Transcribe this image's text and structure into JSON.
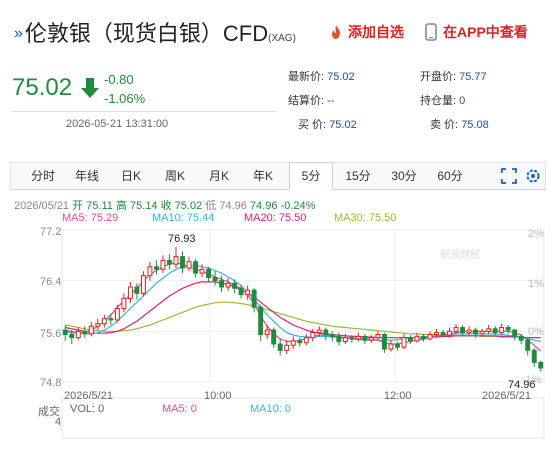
{
  "header": {
    "title": "伦敦银（现货白银）CFD",
    "title_sub": "(XAG)",
    "fav_label": "添加自选",
    "app_label": "在APP中查看"
  },
  "quote": {
    "price": "75.02",
    "change": "-0.80",
    "change_pct": "-1.06%",
    "time": "2026-05-21 13:31:00"
  },
  "stats": {
    "latest_label": "最新价:",
    "latest": "75.02",
    "open_label": "开盘价:",
    "open": "75.77",
    "settle_label": "结算价:",
    "settle": "--",
    "oi_label": "持仓量:",
    "oi": "0",
    "bid_label": "买  价:",
    "bid": "75.02",
    "ask_label": "卖  价:",
    "ask": "75.08"
  },
  "tabs": [
    "分时",
    "年线",
    "日K",
    "周K",
    "月K",
    "年K",
    "5分",
    "15分",
    "30分",
    "60分"
  ],
  "active_tab": "5分",
  "infoline": {
    "date": "2026/05/21",
    "open": "开 75.11",
    "high": "高 75.14",
    "close": "收 75.02",
    "low": "低 74.96",
    "chg": "74.96 -0.24%"
  },
  "ma": {
    "ma5": "MA5: 75.29",
    "ma10": "MA10: 75.44",
    "ma20": "MA20: 75.50",
    "ma30": "MA30: 75.50"
  },
  "colors": {
    "up": "#e02020",
    "down": "#1e8c3a",
    "ma5": "#e84a8a",
    "ma10": "#35b5e5",
    "ma20": "#d4247a",
    "ma30": "#9ab83a"
  },
  "chart": {
    "y_ticks": [
      "77.2",
      "76.4",
      "75.6",
      "74.8"
    ],
    "pct_ticks": [
      "2%",
      "1%",
      "0%",
      "-1%"
    ],
    "x_ticks": [
      "2026/5/21",
      "10:00",
      "12:00",
      "2026/5/21"
    ],
    "max_label": "76.93",
    "min_label": "74.96",
    "watermark": "新浪财经"
  },
  "volume": {
    "label": "成交",
    "value": "4",
    "vol": "VOL: 0",
    "ma5": "MA5: 0",
    "ma10": "MA10: 0"
  },
  "chart_data": {
    "type": "candlestick",
    "ylim": [
      74.8,
      77.2
    ],
    "candles": [
      [
        75.62,
        75.55,
        75.7,
        75.45
      ],
      [
        75.55,
        75.5,
        75.62,
        75.4
      ],
      [
        75.5,
        75.6,
        75.66,
        75.46
      ],
      [
        75.6,
        75.56,
        75.68,
        75.5
      ],
      [
        75.56,
        75.68,
        75.75,
        75.52
      ],
      [
        75.68,
        75.72,
        75.8,
        75.62
      ],
      [
        75.72,
        75.8,
        75.86,
        75.66
      ],
      [
        75.8,
        75.78,
        75.88,
        75.7
      ],
      [
        75.78,
        75.96,
        76.02,
        75.74
      ],
      [
        75.96,
        76.12,
        76.2,
        75.9
      ],
      [
        76.12,
        76.3,
        76.38,
        76.05
      ],
      [
        76.3,
        76.2,
        76.36,
        76.1
      ],
      [
        76.2,
        76.48,
        76.55,
        76.15
      ],
      [
        76.48,
        76.62,
        76.7,
        76.4
      ],
      [
        76.62,
        76.58,
        76.72,
        76.5
      ],
      [
        76.58,
        76.72,
        76.8,
        76.52
      ],
      [
        76.72,
        76.66,
        76.82,
        76.58
      ],
      [
        76.66,
        76.78,
        76.93,
        76.6
      ],
      [
        76.78,
        76.6,
        76.86,
        76.52
      ],
      [
        76.6,
        76.7,
        76.78,
        76.55
      ],
      [
        76.7,
        76.52,
        76.74,
        76.45
      ],
      [
        76.52,
        76.58,
        76.66,
        76.46
      ],
      [
        76.58,
        76.45,
        76.62,
        76.38
      ],
      [
        76.45,
        76.4,
        76.55,
        76.32
      ],
      [
        76.4,
        76.3,
        76.48,
        76.22
      ],
      [
        76.3,
        76.36,
        76.44,
        76.24
      ],
      [
        76.36,
        76.28,
        76.42,
        76.2
      ],
      [
        76.28,
        76.18,
        76.34,
        76.12
      ],
      [
        76.18,
        76.25,
        76.32,
        76.1
      ],
      [
        76.25,
        75.98,
        76.28,
        75.9
      ],
      [
        75.98,
        75.55,
        76.02,
        75.45
      ],
      [
        75.55,
        75.62,
        75.7,
        75.48
      ],
      [
        75.62,
        75.4,
        75.66,
        75.34
      ],
      [
        75.4,
        75.3,
        75.48,
        75.22
      ],
      [
        75.3,
        75.38,
        75.46,
        75.24
      ],
      [
        75.38,
        75.45,
        75.52,
        75.32
      ],
      [
        75.45,
        75.42,
        75.5,
        75.36
      ],
      [
        75.42,
        75.5,
        75.56,
        75.38
      ],
      [
        75.5,
        75.58,
        75.64,
        75.44
      ],
      [
        75.58,
        75.62,
        75.68,
        75.52
      ],
      [
        75.62,
        75.55,
        75.66,
        75.46
      ],
      [
        75.55,
        75.52,
        75.6,
        75.44
      ],
      [
        75.52,
        75.44,
        75.58,
        75.38
      ],
      [
        75.44,
        75.5,
        75.56,
        75.4
      ],
      [
        75.5,
        75.48,
        75.54,
        75.42
      ],
      [
        75.48,
        75.52,
        75.58,
        75.44
      ],
      [
        75.52,
        75.46,
        75.56,
        75.4
      ],
      [
        75.46,
        75.5,
        75.54,
        75.42
      ],
      [
        75.5,
        75.55,
        75.6,
        75.46
      ],
      [
        75.55,
        75.32,
        75.58,
        75.26
      ],
      [
        75.32,
        75.4,
        75.46,
        75.28
      ],
      [
        75.4,
        75.35,
        75.44,
        75.3
      ],
      [
        75.35,
        75.5,
        75.56,
        75.32
      ],
      [
        75.5,
        75.45,
        75.54,
        75.4
      ],
      [
        75.45,
        75.52,
        75.58,
        75.42
      ],
      [
        75.52,
        75.48,
        75.56,
        75.44
      ],
      [
        75.48,
        75.55,
        75.6,
        75.46
      ],
      [
        75.55,
        75.58,
        75.64,
        75.5
      ],
      [
        75.58,
        75.54,
        75.62,
        75.5
      ],
      [
        75.54,
        75.6,
        75.66,
        75.5
      ],
      [
        75.6,
        75.66,
        75.72,
        75.56
      ],
      [
        75.66,
        75.58,
        75.7,
        75.52
      ],
      [
        75.58,
        75.62,
        75.68,
        75.54
      ],
      [
        75.62,
        75.56,
        75.66,
        75.5
      ],
      [
        75.56,
        75.6,
        75.64,
        75.52
      ],
      [
        75.6,
        75.64,
        75.7,
        75.56
      ],
      [
        75.64,
        75.58,
        75.68,
        75.54
      ],
      [
        75.58,
        75.66,
        75.72,
        75.54
      ],
      [
        75.66,
        75.62,
        75.7,
        75.56
      ],
      [
        75.62,
        75.52,
        75.64,
        75.46
      ],
      [
        75.52,
        75.46,
        75.56,
        75.4
      ],
      [
        75.46,
        75.3,
        75.5,
        75.22
      ],
      [
        75.3,
        75.11,
        75.34,
        75.04
      ],
      [
        75.11,
        75.02,
        75.14,
        74.96
      ]
    ],
    "ma5": [
      75.6,
      75.58,
      75.57,
      75.58,
      75.62,
      75.68,
      75.76,
      75.86,
      75.98,
      76.08,
      76.18,
      76.28,
      76.4,
      76.5,
      76.56,
      76.62,
      76.66,
      76.68,
      76.66,
      76.62,
      76.58,
      76.55,
      76.5,
      76.46,
      76.42,
      76.38,
      76.32,
      76.28,
      76.18,
      76.04,
      75.84,
      75.68,
      75.56,
      75.48,
      75.44,
      75.44,
      75.46,
      75.48,
      75.52,
      75.54,
      75.54,
      75.53,
      75.51,
      75.5,
      75.49,
      75.49,
      75.48,
      75.48,
      75.46,
      75.42,
      75.4,
      75.4,
      75.42,
      75.44,
      75.46,
      75.48,
      75.5,
      75.52,
      75.54,
      75.56,
      75.58,
      75.6,
      75.6,
      75.6,
      75.6,
      75.6,
      75.6,
      75.6,
      75.6,
      75.58,
      75.54,
      75.46,
      75.38,
      75.29
    ],
    "ma10": [
      75.62,
      75.6,
      75.58,
      75.56,
      75.56,
      75.58,
      75.62,
      75.68,
      75.76,
      75.86,
      75.96,
      76.06,
      76.16,
      76.26,
      76.36,
      76.44,
      76.52,
      76.58,
      76.62,
      76.64,
      76.64,
      76.62,
      76.6,
      76.56,
      76.52,
      76.46,
      76.4,
      76.32,
      76.22,
      76.1,
      75.98,
      75.86,
      75.76,
      75.66,
      75.58,
      75.54,
      75.52,
      75.51,
      75.51,
      75.52,
      75.52,
      75.51,
      75.5,
      75.49,
      75.48,
      75.47,
      75.46,
      75.46,
      75.46,
      75.46,
      75.46,
      75.47,
      75.48,
      75.49,
      75.5,
      75.51,
      75.52,
      75.53,
      75.54,
      75.55,
      75.56,
      75.56,
      75.56,
      75.56,
      75.56,
      75.56,
      75.56,
      75.55,
      75.54,
      75.52,
      75.5,
      75.48,
      75.46,
      75.44
    ],
    "ma20": [
      75.66,
      75.64,
      75.62,
      75.6,
      75.58,
      75.57,
      75.57,
      75.58,
      75.6,
      75.64,
      75.7,
      75.76,
      75.84,
      75.92,
      76.0,
      76.08,
      76.16,
      76.22,
      76.28,
      76.32,
      76.36,
      76.38,
      76.38,
      76.38,
      76.36,
      76.34,
      76.3,
      76.26,
      76.2,
      76.14,
      76.06,
      75.98,
      75.9,
      75.82,
      75.76,
      75.7,
      75.66,
      75.62,
      75.59,
      75.57,
      75.56,
      75.55,
      75.54,
      75.53,
      75.52,
      75.52,
      75.51,
      75.51,
      75.5,
      75.5,
      75.5,
      75.5,
      75.5,
      75.5,
      75.5,
      75.5,
      75.51,
      75.51,
      75.52,
      75.52,
      75.53,
      75.53,
      75.53,
      75.53,
      75.53,
      75.53,
      75.53,
      75.52,
      75.52,
      75.51,
      75.51,
      75.5,
      75.5,
      75.5
    ],
    "ma30": [
      75.7,
      75.68,
      75.66,
      75.64,
      75.62,
      75.61,
      75.6,
      75.6,
      75.6,
      75.61,
      75.62,
      75.64,
      75.67,
      75.7,
      75.74,
      75.78,
      75.82,
      75.86,
      75.9,
      75.94,
      75.98,
      76.01,
      76.03,
      76.05,
      76.06,
      76.06,
      76.05,
      76.04,
      76.02,
      76.0,
      75.97,
      75.94,
      75.91,
      75.88,
      75.85,
      75.82,
      75.79,
      75.76,
      75.74,
      75.72,
      75.7,
      75.68,
      75.67,
      75.66,
      75.65,
      75.64,
      75.63,
      75.62,
      75.61,
      75.6,
      75.59,
      75.58,
      75.57,
      75.56,
      75.56,
      75.55,
      75.55,
      75.54,
      75.54,
      75.54,
      75.53,
      75.53,
      75.53,
      75.53,
      75.52,
      75.52,
      75.52,
      75.51,
      75.51,
      75.51,
      75.51,
      75.5,
      75.5,
      75.5
    ]
  }
}
